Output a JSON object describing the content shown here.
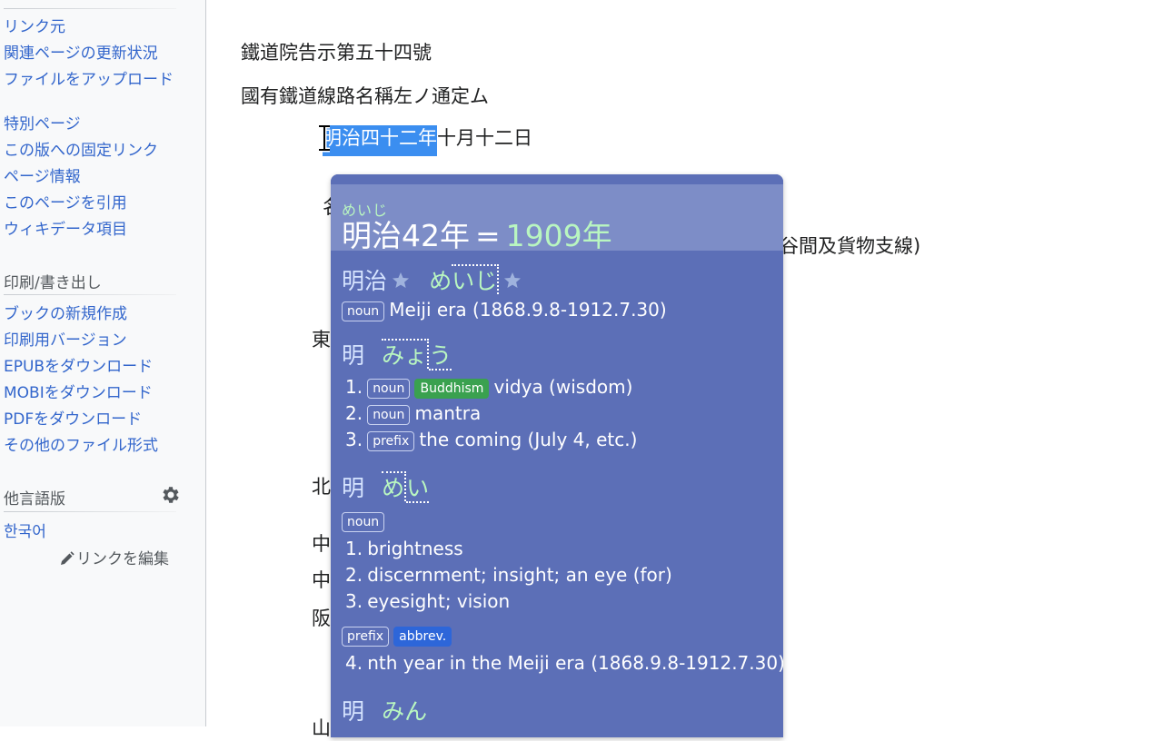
{
  "sidebar": {
    "links_top": [
      {
        "label": "リンク元"
      },
      {
        "label": "関連ページの更新状況"
      },
      {
        "label": "ファイルをアップロード"
      },
      {
        "label": "特別ページ"
      },
      {
        "label": "この版への固定リンク"
      },
      {
        "label": "ページ情報"
      },
      {
        "label": "このページを引用"
      },
      {
        "label": "ウィキデータ項目"
      }
    ],
    "print_heading": "印刷/書き出し",
    "print_links": [
      {
        "label": "ブックの新規作成"
      },
      {
        "label": "印刷用バージョン"
      },
      {
        "label": "EPUBをダウンロード"
      },
      {
        "label": "MOBIをダウンロード"
      },
      {
        "label": "PDFをダウンロード"
      },
      {
        "label": "その他のファイル形式"
      }
    ],
    "lang_heading": "他言語版",
    "lang_links": [
      {
        "label": "한국어"
      }
    ],
    "edit_links": "リンクを編集"
  },
  "content": {
    "line1": "鐵道院告示第五十四號",
    "line2": "國有鐵道線路名稱左ノ通定ム",
    "date_selected": "明治四十二年",
    "date_rest": "十月十二日",
    "frag_a": "名",
    "frag_b": "谷間及貨物支線)",
    "frag_c": "東",
    "frag_d": "北",
    "frag_e": "中",
    "frag_f": "中",
    "frag_g": "阪",
    "frag_h": "山"
  },
  "popup": {
    "ruby": "めいじ",
    "conv_era": "明治42年",
    "conv_eq": "=",
    "conv_year": "1909年",
    "e1": {
      "kanji": "明治",
      "kana_pre": "め",
      "kana_acc": "いじ",
      "tag": "noun",
      "def": "Meiji era (1868.9.8-1912.7.30)"
    },
    "e2": {
      "kanji": "明",
      "kana_pre": "みょ",
      "kana_acc": "う",
      "senses": [
        {
          "num": "1.",
          "tags": [
            "noun",
            "Buddhism"
          ],
          "text": "vidya (wisdom)"
        },
        {
          "num": "2.",
          "tags": [
            "noun"
          ],
          "text": "mantra"
        },
        {
          "num": "3.",
          "tags": [
            "prefix"
          ],
          "text": "the coming (July 4, etc.)"
        }
      ]
    },
    "e3": {
      "kanji": "明",
      "kana_pre": "め",
      "kana_acc": "い",
      "tag": "noun",
      "senses": [
        {
          "num": "1.",
          "text": "brightness"
        },
        {
          "num": "2.",
          "text": "discernment; insight; an eye (for)"
        },
        {
          "num": "3.",
          "text": "eyesight; vision"
        }
      ],
      "tag2": "prefix",
      "tag3": "abbrev.",
      "sense4": {
        "num": "4.",
        "text": "nth year in the Meiji era (1868.9.8-1912.7.30)"
      }
    },
    "e4": {
      "kanji": "明",
      "kana": "みん"
    }
  },
  "colors": {
    "link": "#3366cc",
    "popup_bg": "#5c6fb7",
    "popup_header": "#7d8dc7",
    "kana": "#b9f6c0",
    "selection": "#3b8ef0",
    "tag_buddhism": "#3aa14f",
    "tag_abbrev": "#2d66d9"
  }
}
